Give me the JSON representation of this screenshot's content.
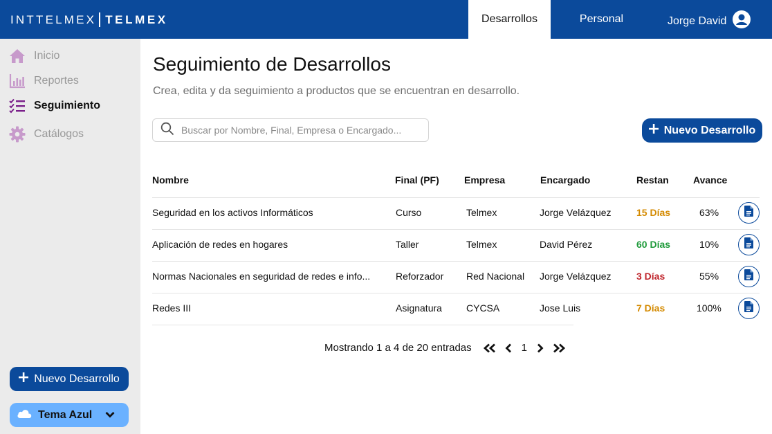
{
  "brand": {
    "part1": "INTTELMEX",
    "part2": "TELMEX"
  },
  "nav": {
    "tabs": [
      {
        "label": "Desarrollos",
        "active": true
      },
      {
        "label": "Personal",
        "active": false
      }
    ],
    "user_name": "Jorge David"
  },
  "sidebar": {
    "items": [
      {
        "label": "Inicio",
        "icon": "home-icon"
      },
      {
        "label": "Reportes",
        "icon": "bar-chart-icon"
      },
      {
        "label": "Seguimiento",
        "icon": "checklist-icon",
        "active": true
      },
      {
        "label": "Catálogos",
        "icon": "gear-icon"
      }
    ],
    "new_button_label": "Nuevo Desarrollo",
    "theme_label": "Tema Azul"
  },
  "main": {
    "title": "Seguimiento de Desarrollos",
    "subtitle": "Crea, edita y da seguimiento a productos que se encuentran en desarrollo.",
    "search_placeholder": "Buscar por Nombre, Final, Empresa o Encargado...",
    "new_button_label": "Nuevo Desarrollo"
  },
  "table": {
    "headers": [
      "Nombre",
      "Final (PF)",
      "Empresa",
      "Encargado",
      "Restan",
      "Avance"
    ],
    "rows": [
      {
        "nombre": "Seguridad en los activos Informáticos",
        "final": "Curso",
        "empresa": "Telmex",
        "encargado": "Jorge Velázquez",
        "restan": "15 Días",
        "restan_color": "#d48a00",
        "avance": "63%"
      },
      {
        "nombre": "Aplicación de redes en hogares",
        "final": "Taller",
        "empresa": "Telmex",
        "encargado": "David Pérez",
        "restan": "60 Días",
        "restan_color": "#1e9a3a",
        "avance": "10%"
      },
      {
        "nombre": "Normas Nacionales en seguridad de redes e info...",
        "final": "Reforzador",
        "empresa": "Red Nacional",
        "encargado": "Jorge Velázquez",
        "restan": "3 Días",
        "restan_color": "#c0262d",
        "avance": "55%"
      },
      {
        "nombre": "Redes III",
        "final": "Asignatura",
        "empresa": "CYCSA",
        "encargado": "Jose Luis",
        "restan": "7 Días",
        "restan_color": "#d48a00",
        "avance": "100%"
      }
    ]
  },
  "pagination": {
    "summary": "Mostrando 1 a 4 de 20 entradas",
    "current_page": "1"
  },
  "colors": {
    "primary": "#0b4a9b",
    "accent_light": "#6ab1ff",
    "sidebar_icon": "#b45ab9",
    "sidebar_active_icon": "#7a1f8a"
  }
}
